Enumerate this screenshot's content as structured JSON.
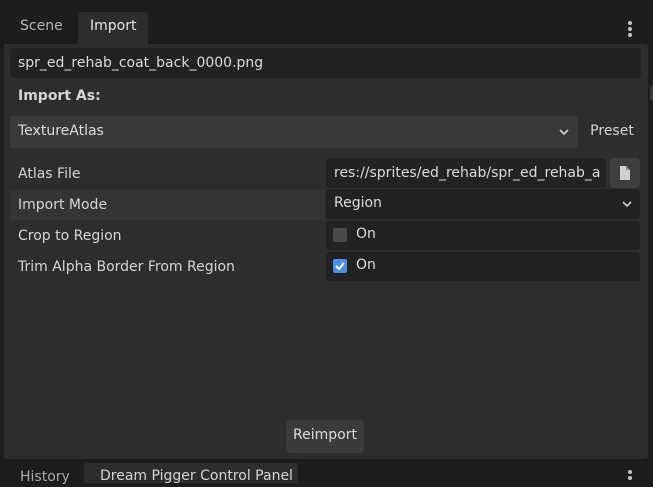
{
  "tabs": [
    {
      "label": "Scene",
      "active": false
    },
    {
      "label": "Import",
      "active": true
    }
  ],
  "import": {
    "file_name": "spr_ed_rehab_coat_back_0000.png",
    "import_as_label": "Import As:",
    "importer_value": "TextureAtlas",
    "preset_label": "Preset",
    "properties": {
      "atlas_file": {
        "label": "Atlas File",
        "value": "res://sprites/ed_rehab/spr_ed_rehab_a"
      },
      "import_mode": {
        "label": "Import Mode",
        "value": "Region"
      },
      "crop_to_region": {
        "label": "Crop to Region",
        "checked": false,
        "toggle_label": "On"
      },
      "trim_alpha": {
        "label": "Trim Alpha Border From Region",
        "checked": true,
        "toggle_label": "On"
      }
    },
    "reimport_label": "Reimport"
  },
  "bottom_tabs": [
    {
      "label": "History",
      "active": false
    },
    {
      "label": "Dream Pigger Control Panel",
      "active": true
    }
  ],
  "colors": {
    "accent": "#4c8ee8",
    "panel_bg": "#2d2d2d",
    "field_bg": "#222222"
  },
  "icons": {
    "menu": "kebab-vertical-icon",
    "dropdown": "chevron-down-icon",
    "file": "file-icon",
    "checkbox_checked": "checkmark-icon"
  }
}
